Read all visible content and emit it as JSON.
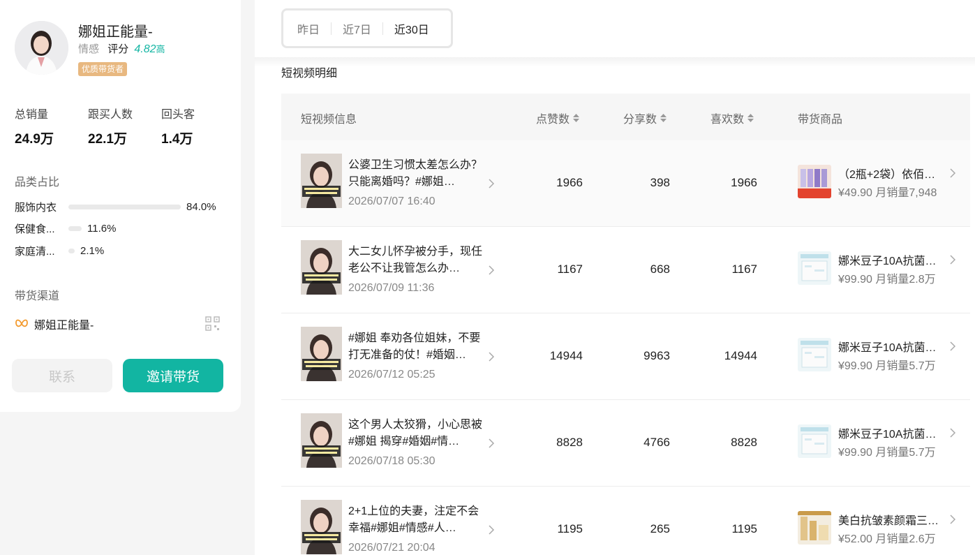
{
  "profile": {
    "name": "娜姐正能量-",
    "category": "情感",
    "score_label": "评分",
    "score": "4.82",
    "score_level": "高",
    "badge": "优质带货者"
  },
  "stats": [
    {
      "label": "总销量",
      "value": "24.9万"
    },
    {
      "label": "跟买人数",
      "value": "22.1万"
    },
    {
      "label": "回头客",
      "value": "1.4万"
    }
  ],
  "category_section": {
    "title": "品类占比",
    "items": [
      {
        "name": "服饰内衣",
        "percent": "84.0%",
        "fraction": 0.84
      },
      {
        "name": "保健食...",
        "percent": "11.6%",
        "fraction": 0.116
      },
      {
        "name": "家庭清...",
        "percent": "2.1%",
        "fraction": 0.021
      }
    ]
  },
  "channel_section": {
    "title": "带货渠道",
    "channel_name": "娜姐正能量-"
  },
  "buttons": {
    "contact": "联系",
    "invite": "邀请带货"
  },
  "tabs": [
    "昨日",
    "近7日",
    "近30日"
  ],
  "active_tab": "近30日",
  "section_title": "短视频明细",
  "table": {
    "headers": {
      "info": "短视频信息",
      "likes": "点赞数",
      "shares": "分享数",
      "favorites": "喜欢数",
      "product": "带货商品"
    },
    "rows": [
      {
        "title": "公婆卫生习惯太差怎么办？只能离婚吗？#娜姐…",
        "date": "2026/07/07 16:40",
        "likes": "1966",
        "shares": "398",
        "favorites": "1966",
        "product_name": "（2瓶+2袋）依佰…",
        "product_price": "¥49.90 月销量7,948"
      },
      {
        "title": "大二女儿怀孕被分手，现任老公不让我管怎么办…",
        "date": "2026/07/09 11:36",
        "likes": "1167",
        "shares": "668",
        "favorites": "1167",
        "product_name": "娜米豆子10A抗菌…",
        "product_price": "¥99.90 月销量2.8万"
      },
      {
        "title": "#娜姐 奉劝各位姐妹，不要打无准备的仗！#婚姻…",
        "date": "2026/07/12 05:25",
        "likes": "14944",
        "shares": "9963",
        "favorites": "14944",
        "product_name": "娜米豆子10A抗菌…",
        "product_price": "¥99.90 月销量5.7万"
      },
      {
        "title": "这个男人太狡猾，小心思被#娜姐 揭穿#婚姻#情…",
        "date": "2026/07/18 05:30",
        "likes": "8828",
        "shares": "4766",
        "favorites": "8828",
        "product_name": "娜米豆子10A抗菌…",
        "product_price": "¥99.90 月销量5.7万"
      },
      {
        "title": "2+1上位的夫妻，注定不会幸福#娜姐#情感#人…",
        "date": "2026/07/21 20:04",
        "likes": "1195",
        "shares": "265",
        "favorites": "1195",
        "product_name": "美白抗皱素颜霜三…",
        "product_price": "¥52.00 月销量2.6万"
      }
    ]
  },
  "colors": {
    "accent": "#12b5a2",
    "badge": "#e8b880",
    "score": "#16b6a4"
  }
}
